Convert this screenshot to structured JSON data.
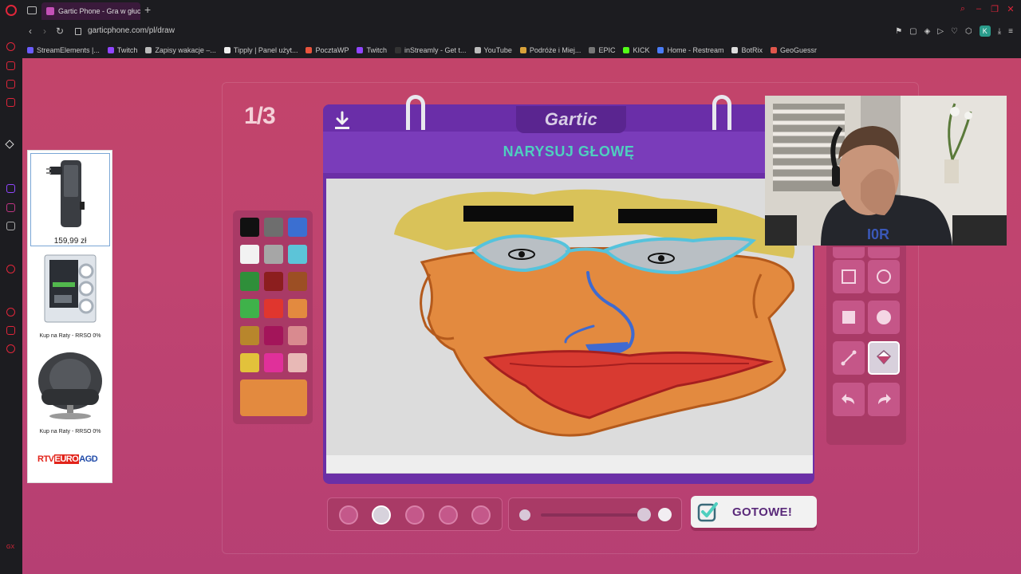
{
  "browser": {
    "tab_title": "Gartic Phone - Gra w głuc",
    "new_tab": "+",
    "url": "garticphone.com/pl/draw",
    "profile_initial": "K",
    "bookmarks": [
      {
        "label": "StreamElements |...",
        "color": "#6b5cff"
      },
      {
        "label": "Twitch",
        "color": "#9146ff"
      },
      {
        "label": "Zapisy wakacje –...",
        "color": "#bbbbbb"
      },
      {
        "label": "Tipply | Panel użyt...",
        "color": "#eeeeee"
      },
      {
        "label": "PocztaWP",
        "color": "#e8543d"
      },
      {
        "label": "Twitch",
        "color": "#9146ff"
      },
      {
        "label": "inStreamly - Get t...",
        "color": "#333333"
      },
      {
        "label": "YouTube",
        "color": "#bbbbbb"
      },
      {
        "label": "Podróże i Miej...",
        "color": "#d9a23a"
      },
      {
        "label": "EPIC",
        "color": "#777777"
      },
      {
        "label": "KICK",
        "color": "#53fc18"
      },
      {
        "label": "Home - Restream",
        "color": "#4a7cf7"
      },
      {
        "label": "BotRix",
        "color": "#dddddd"
      },
      {
        "label": "GeoGuessr",
        "color": "#e0564c"
      }
    ]
  },
  "game": {
    "counter": "1/3",
    "logo": "Gartic",
    "prompt": "NARYSUJ GŁOWĘ",
    "done_label": "GOTOWE!",
    "selected_color": "#e38a3f",
    "palette": [
      "#111111",
      "#6e6e6e",
      "#3b6fd1",
      "#f2f2f2",
      "#a6a6a6",
      "#5cc4d8",
      "#2f8f3a",
      "#8c1e1e",
      "#9c4f24",
      "#3fb24a",
      "#e0362e",
      "#e38a3f",
      "#b8862c",
      "#a3155a",
      "#d98a8f",
      "#e2c23b",
      "#e0309a",
      "#e8b9b6"
    ],
    "brush_sizes_selected": 1,
    "opacity_selected": 1
  },
  "ads": {
    "items": [
      {
        "price": "159,99 zł",
        "caption": ""
      },
      {
        "price": "",
        "caption": "Kup na Raty - RRSO 0%"
      },
      {
        "price": "",
        "caption": "Kup na Raty - RRSO 0%"
      }
    ],
    "logo_parts": [
      "RTV",
      "EURO",
      "AGD"
    ]
  }
}
